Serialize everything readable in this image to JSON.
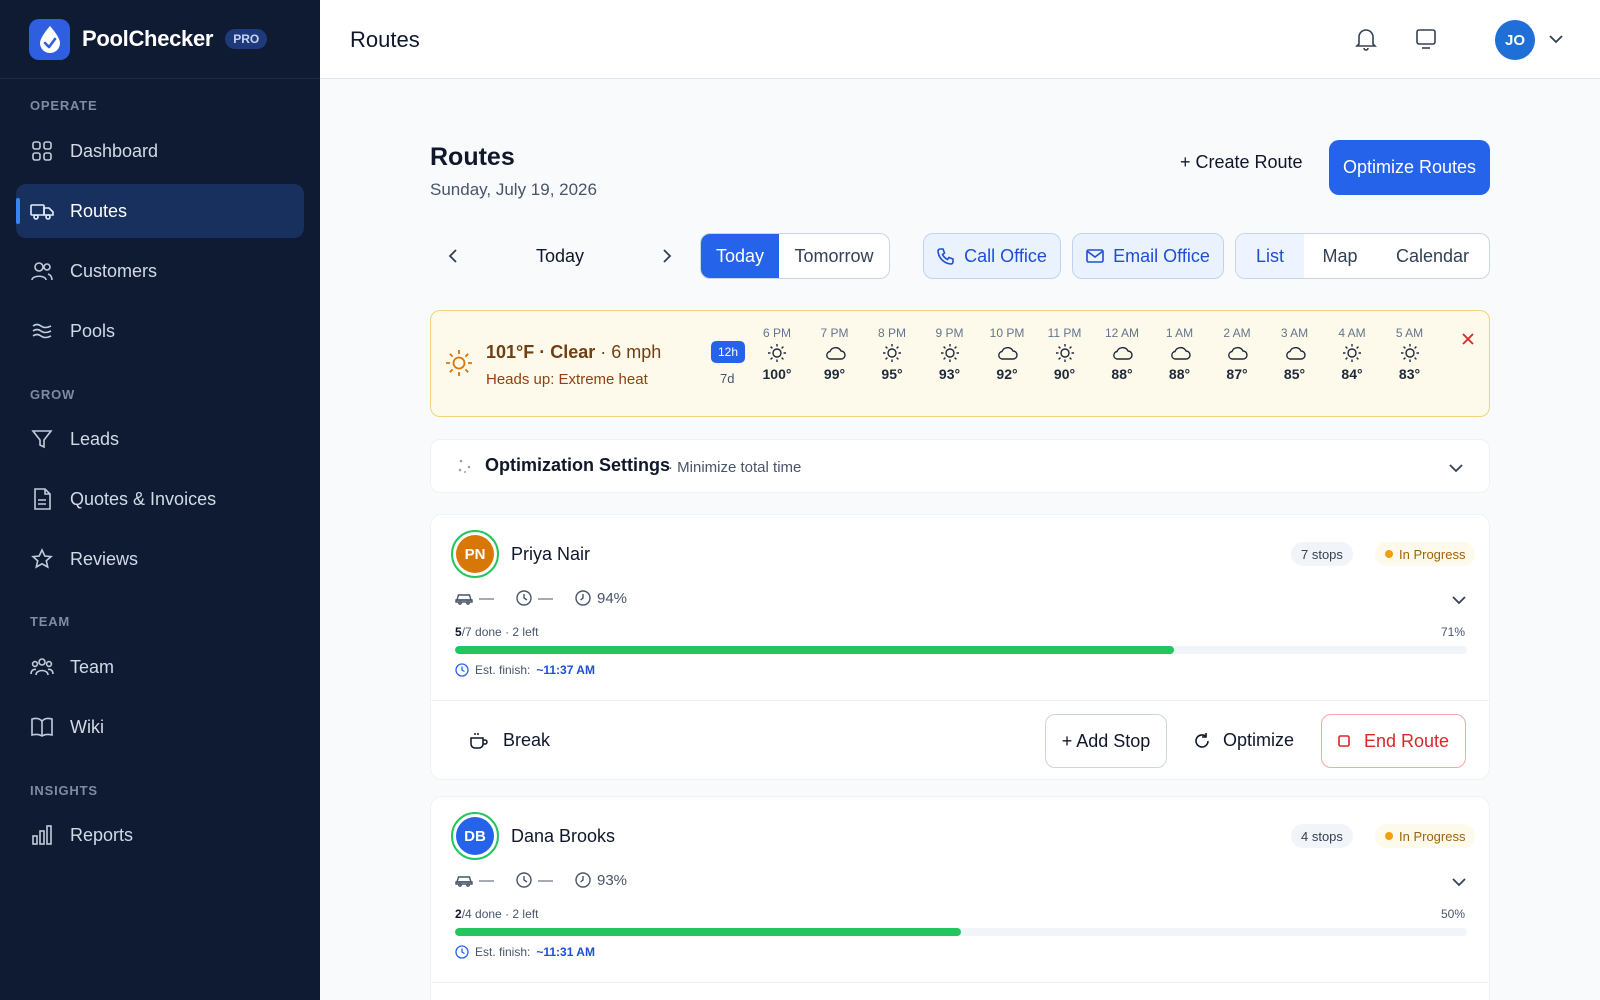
{
  "app": {
    "name": "PoolChecker",
    "badge": "PRO"
  },
  "sidebar": {
    "sections": [
      {
        "label": "OPERATE"
      },
      {
        "label": "GROW"
      },
      {
        "label": "TEAM"
      },
      {
        "label": "INSIGHTS"
      }
    ],
    "items": [
      {
        "label": "Dashboard",
        "icon": "grid-icon"
      },
      {
        "label": "Routes",
        "icon": "truck-icon",
        "active": true
      },
      {
        "label": "Customers",
        "icon": "users-icon"
      },
      {
        "label": "Pools",
        "icon": "waves-icon"
      },
      {
        "label": "Leads",
        "icon": "funnel-icon"
      },
      {
        "label": "Quotes & Invoices",
        "icon": "document-icon"
      },
      {
        "label": "Reviews",
        "icon": "star-icon"
      },
      {
        "label": "Team",
        "icon": "team-icon"
      },
      {
        "label": "Wiki",
        "icon": "book-icon"
      },
      {
        "label": "Reports",
        "icon": "bar-chart-icon"
      }
    ]
  },
  "topbar": {
    "title": "Routes",
    "avatar_initials": "JO"
  },
  "main": {
    "title": "Routes",
    "date": "Sunday, July 19, 2026",
    "create_label": "+ Create Route",
    "optimize_label": "Optimize Routes",
    "day_label": "Today",
    "day_tabs": [
      "Today",
      "Tomorrow"
    ],
    "call_label": "Call Office",
    "email_label": "Email Office",
    "view_tabs": [
      "List",
      "Map",
      "Calendar"
    ]
  },
  "weather": {
    "temp": "101°F · Clear",
    "wind": " · 6 mph",
    "warning": "Heads up: Extreme heat",
    "range_12h": "12h",
    "range_7d": "7d",
    "hours": [
      {
        "label": "6 PM",
        "temp": "100°",
        "icon": "sun"
      },
      {
        "label": "7 PM",
        "temp": "99°",
        "icon": "cloud"
      },
      {
        "label": "8 PM",
        "temp": "95°",
        "icon": "sun"
      },
      {
        "label": "9 PM",
        "temp": "93°",
        "icon": "sun"
      },
      {
        "label": "10 PM",
        "temp": "92°",
        "icon": "cloud"
      },
      {
        "label": "11 PM",
        "temp": "90°",
        "icon": "sun"
      },
      {
        "label": "12 AM",
        "temp": "88°",
        "icon": "cloud"
      },
      {
        "label": "1 AM",
        "temp": "88°",
        "icon": "cloud"
      },
      {
        "label": "2 AM",
        "temp": "87°",
        "icon": "cloud"
      },
      {
        "label": "3 AM",
        "temp": "85°",
        "icon": "cloud"
      },
      {
        "label": "4 AM",
        "temp": "84°",
        "icon": "sun"
      },
      {
        "label": "5 AM",
        "temp": "83°",
        "icon": "sun"
      }
    ]
  },
  "optimization": {
    "title": "Optimization Settings",
    "subtitle": "· Minimize total time"
  },
  "routes": [
    {
      "initials": "PN",
      "name": "Priya Nair",
      "color": "#d97706",
      "stops": "7 stops",
      "status": "In Progress",
      "distance": "—",
      "duration": "—",
      "score": "94%",
      "done": "5",
      "done_rest": "/7 done",
      "left": " · 2 left",
      "percent": "71%",
      "progress": 0.71,
      "finish_label": "Est. finish:",
      "finish": "~11:37 AM",
      "break_label": "Break",
      "add_stop_label": "+ Add Stop",
      "optimize_label": "Optimize",
      "end_label": "End Route"
    },
    {
      "initials": "DB",
      "name": "Dana Brooks",
      "color": "#2563eb",
      "stops": "4 stops",
      "status": "In Progress",
      "distance": "—",
      "duration": "—",
      "score": "93%",
      "done": "2",
      "done_rest": "/4 done",
      "left": " · 2 left",
      "percent": "50%",
      "progress": 0.5,
      "finish_label": "Est. finish:",
      "finish": "~11:31 AM"
    }
  ]
}
